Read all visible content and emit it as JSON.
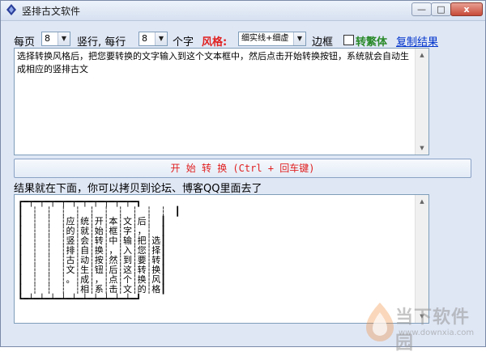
{
  "window": {
    "title": "竖排古文软件",
    "close_label": "x",
    "max_label": "□",
    "min_label": "—"
  },
  "options": {
    "per_page_label": "每页",
    "per_page_value": "8",
    "columns_label": "竖行, 每行",
    "per_line_value": "8",
    "chars_label": "个字",
    "style_label": "风格:",
    "style_value": "细实线+细虚",
    "border_label": "边框",
    "traditional_label": "转繁体",
    "traditional_checked": false,
    "copy_label": "复制结果"
  },
  "input": {
    "text": "选择转换风格后，把您要转换的文字输入到这个文本框中，然后点击开始转换按钮，系统就会自动生成相应的竖排古文"
  },
  "convert_button": {
    "label": "开 始 转 换  (Ctrl + 回车键)"
  },
  "result": {
    "label": "结果就在下面，你可以拷贝到论坛、博客QQ里面去了",
    "lines": [
      "┏━┯━┯━┯━┯━┯━┯━┯━┯━┯━┯━┓",
      "┃　┆　┆　┆　┆　┆　┆　┆　┆　┆　┆　┃",
      "┃　┆　┆　┆应┆统┆开┆本┆文┆后┆　┃",
      "┃　┆　┆　┆的┆就┆始┆框┆字┆，┆　┃",
      "┃　┆　┆　┆竖┆会┆转┆中┆输┆把┆选┃",
      "┃　┆　┆　┆排┆自┆换┆，┆入┆您┆择┃",
      "┃　┆　┆　┆古┆动┆按┆然┆到┆要┆转┃",
      "┃　┆　┆　┆文┆生┆钮┆后┆这┆转┆换┃",
      "┃　┆　┆　┆。┆成┆，┆点┆个┆换┆风┃",
      "┃　┆　┆　┆　┆相┆系┆击┆文┆的┆格┃",
      "┗━┷━┷━┷━┷━┷━┷━┷━┷━┷━┷━┛"
    ]
  },
  "watermark": {
    "name": "当下软件园",
    "url": "www.downxia.com"
  },
  "colors": {
    "accent_red": "#e02020",
    "trad_green": "#2a8a2a",
    "link_blue": "#0033cc",
    "window_bg": "#dfe7f5"
  }
}
